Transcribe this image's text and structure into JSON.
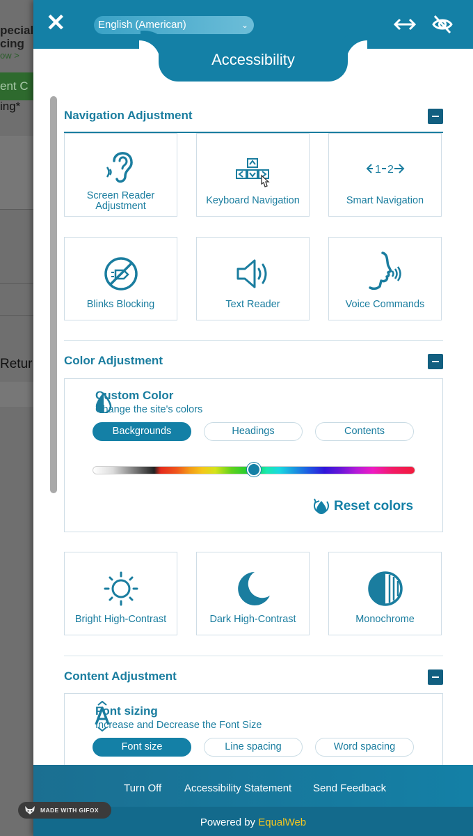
{
  "background_site": {
    "fragment_1": "pecial\ncing",
    "fragment_2": "ow >",
    "fragment_3": "ent  C",
    "fragment_4": "ing*",
    "fragment_5": "Retur"
  },
  "header": {
    "language": "English (American)",
    "title": "Accessibility"
  },
  "sections": {
    "navigation": {
      "title": "Navigation Adjustment",
      "tiles": [
        {
          "label": "Screen Reader Adjustment",
          "icon": "ear-icon"
        },
        {
          "label": "Keyboard Navigation",
          "icon": "keyboard-arrows-icon"
        },
        {
          "label": "Smart Navigation",
          "icon": "smart-navigation-icon"
        },
        {
          "label": "Blinks Blocking",
          "icon": "blink-block-icon"
        },
        {
          "label": "Text Reader",
          "icon": "speaker-icon"
        },
        {
          "label": "Voice Commands",
          "icon": "voice-head-icon"
        }
      ]
    },
    "color": {
      "title": "Color Adjustment",
      "custom_color": {
        "title": "Custom Color",
        "subtitle": "Change the site's colors",
        "options": [
          "Backgrounds",
          "Headings",
          "Contents"
        ],
        "selected": "Backgrounds",
        "slider_position_pct": 50,
        "reset_label": "Reset colors"
      },
      "tiles": [
        {
          "label": "Bright High-Contrast",
          "icon": "sun-icon"
        },
        {
          "label": "Dark High-Contrast",
          "icon": "moon-icon"
        },
        {
          "label": "Monochrome",
          "icon": "monochrome-icon"
        }
      ]
    },
    "content": {
      "title": "Content Adjustment",
      "font_sizing": {
        "title": "Font sizing",
        "subtitle": "Increase and Decrease the Font Size",
        "options": [
          "Font size",
          "Line spacing",
          "Word spacing"
        ],
        "selected": "Font size"
      }
    }
  },
  "footer": {
    "links": [
      "Turn Off",
      "Accessibility Statement",
      "Send Feedback"
    ],
    "powered_by": "Powered by",
    "brand": "EqualWeb"
  },
  "watermark": "MADE WITH GIFOX",
  "colors": {
    "accent": "#1480a6",
    "text": "#1a7d9f",
    "brand_yellow": "#f7c81e"
  }
}
